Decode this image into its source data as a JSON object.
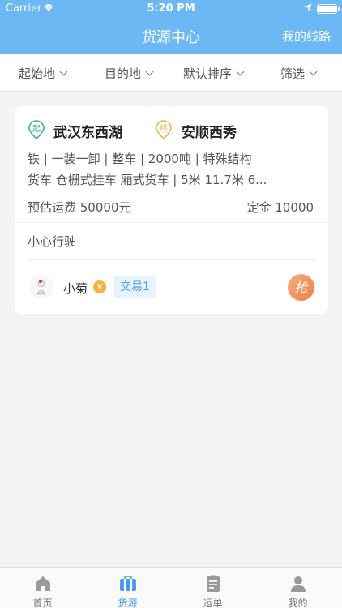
{
  "status_bar": {
    "carrier": "Carrier",
    "time": "5:20 PM"
  },
  "nav": {
    "title": "货源中心",
    "right_action": "我的线路"
  },
  "filters": [
    {
      "label": "起始地"
    },
    {
      "label": "目的地"
    },
    {
      "label": "默认排序"
    },
    {
      "label": "筛选"
    }
  ],
  "card": {
    "origin_badge": "起",
    "origin": "武汉东西湖",
    "destination_badge": "终",
    "destination": "安顺西秀",
    "specs": "铁 | 一装一卸 | 整车 | 2000吨 | 特殊结构",
    "vehicles": "货车 仓栅式挂车 厢式货车 | 5米 11.7米 6...",
    "estimated_fee": "预估运费 50000元",
    "deposit": "定金 10000",
    "note": "小心行驶",
    "user_name": "小菊",
    "verified_badge": "v",
    "trade_count": "交易1",
    "grab_label": "抢"
  },
  "tabs": [
    {
      "label": "首页",
      "icon": "home-icon"
    },
    {
      "label": "货源",
      "icon": "cargo-icon",
      "active": true
    },
    {
      "label": "运单",
      "icon": "waybill-icon"
    },
    {
      "label": "我的",
      "icon": "profile-icon"
    }
  ],
  "colors": {
    "primary": "#6bb8f5",
    "active_tab": "#4a9ee8",
    "origin": "#3fb58f",
    "destination": "#f3b33c",
    "grab": "#f07c4a"
  }
}
